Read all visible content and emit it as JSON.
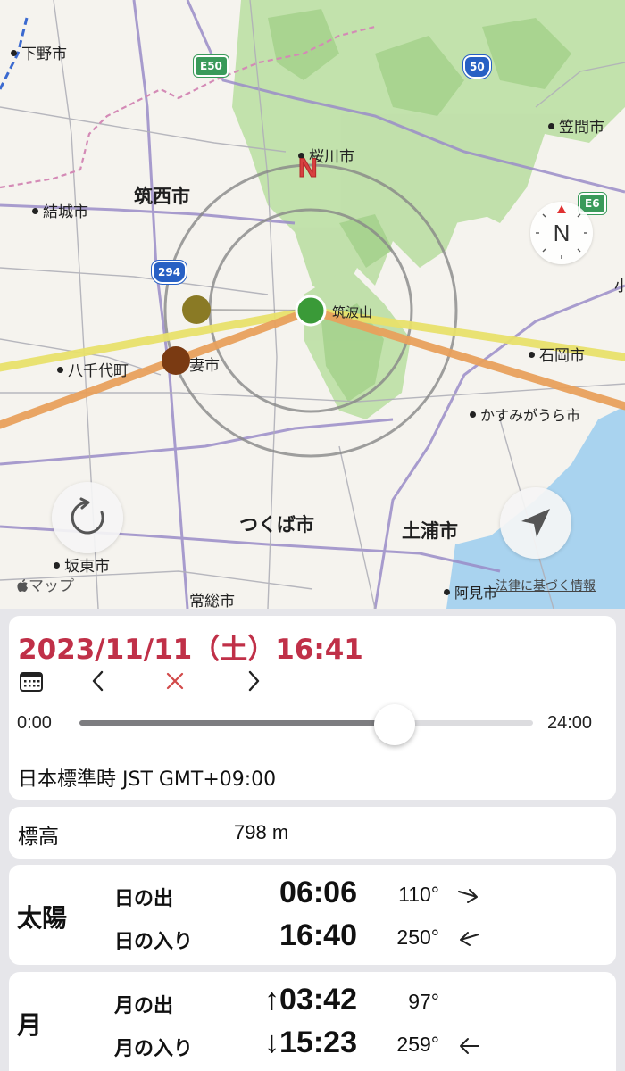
{
  "map": {
    "labels": {
      "shimotsuke": "下野市",
      "kasama": "笠間市",
      "sakuragawa": "桜川市",
      "chikusei": "筑西市",
      "yuki": "結城市",
      "tsukubasan": "筑波山",
      "ishioka": "石岡市",
      "yachiyo": "八千代町",
      "shimotsuma": "妻市",
      "kasumigaura": "かすみがうら市",
      "tsukuba": "つくば市",
      "tsuchiura": "土浦市",
      "bando": "坂東市",
      "joso": "常総市",
      "ami": "阿見市",
      "edge_ko": "小"
    },
    "shields": {
      "e50": "E50",
      "r50": "50",
      "r294": "294",
      "e6": "E6"
    },
    "north_mark": "N",
    "compass_letter": "N",
    "attribution": "マップ",
    "legal_link": "法律に基づく情報",
    "colors": {
      "sun_line": "#e8e06a",
      "moon_line": "#e8a05c",
      "center_marker": "#3a9a38",
      "sun_marker": "#8a7a25",
      "moon_marker": "#7a3a12"
    }
  },
  "panel": {
    "datetime": "2023/11/11（土）16:41",
    "calendar_icon": "calendar-icon",
    "prev_label": "<",
    "clear_label": "✕",
    "next_label": ">",
    "slider": {
      "min_label": "0:00",
      "max_label": "24:00",
      "value_fraction": 0.6958
    },
    "timezone": "日本標準時 JST GMT+09:00",
    "date_color": "#c03048"
  },
  "elevation": {
    "label": "標高",
    "value": "798 m"
  },
  "sun": {
    "name": "太陽",
    "rise": {
      "label": "日の出",
      "time": "06:06",
      "azimuth": "110°",
      "arrow_icon": "arrow-right-down-icon"
    },
    "set": {
      "label": "日の入り",
      "time": "16:40",
      "azimuth": "250°",
      "arrow_icon": "arrow-left-down-icon"
    }
  },
  "moon": {
    "name": "月",
    "rise": {
      "label": "月の出",
      "time": "↑03:42",
      "azimuth": "97°"
    },
    "set": {
      "label": "月の入り",
      "time": "↓15:23",
      "azimuth": "259°",
      "arrow_icon": "arrow-left-icon"
    }
  }
}
